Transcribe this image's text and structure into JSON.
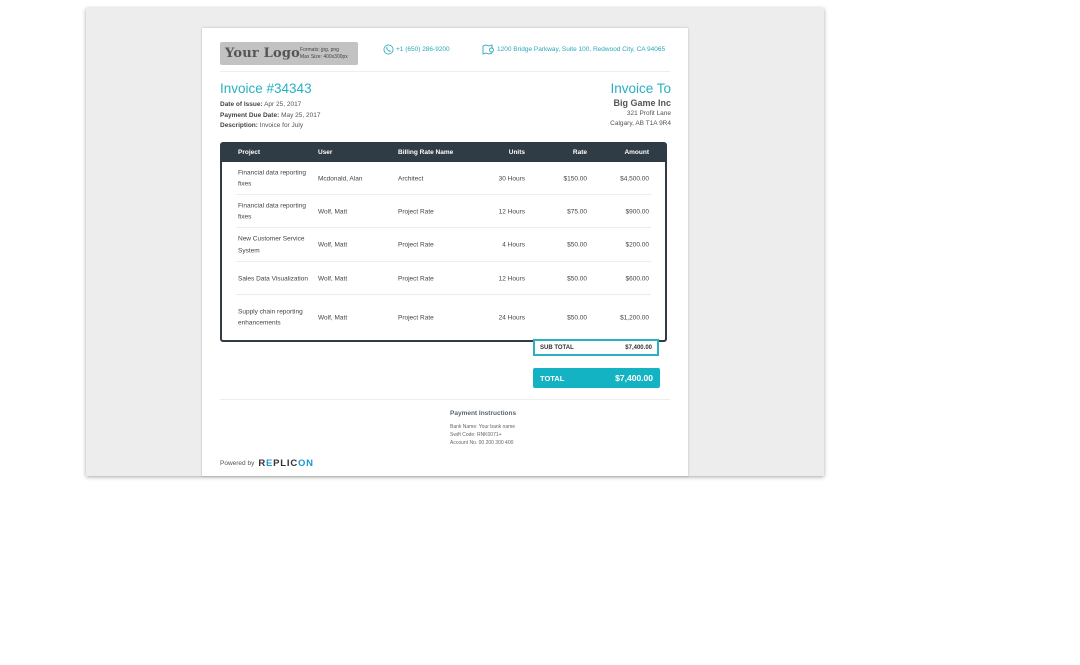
{
  "logo": {
    "text": "Your Logo",
    "formats": "Formats: jpg, png",
    "max_size": "Max Size: 400x300px"
  },
  "header": {
    "phone": "+1 (650) 286-9200",
    "address": "1200 Bridge Parkway, Suite 100, Redwood City, CA 94065"
  },
  "invoice": {
    "title": "Invoice #34343",
    "date_label": "Date of Issue:",
    "date_value": "Apr 25, 2017",
    "due_label": "Payment Due Date:",
    "due_value": "May 25, 2017",
    "desc_label": "Description:",
    "desc_value": "Invoice for July"
  },
  "invoice_to": {
    "title": "Invoice To",
    "company": "Big Game Inc",
    "address_line1": "321 Profit Lane",
    "address_line2": "Calgary, AB T1A 9R4"
  },
  "table": {
    "headers": [
      "Project",
      "User",
      "Billing Rate Name",
      "Units",
      "Rate",
      "Amount"
    ],
    "rows": [
      {
        "project": "Financial data reporting fixes",
        "user": "Mcdonald, Alan",
        "billing": "Architect",
        "units": "30 Hours",
        "rate": "$150.00",
        "amount": "$4,500.00"
      },
      {
        "project": "Financial data reporting fixes",
        "user": "Wolf, Matt",
        "billing": "Project Rate",
        "units": "12 Hours",
        "rate": "$75.00",
        "amount": "$900.00"
      },
      {
        "project": "New Customer Service System",
        "user": "Wolf, Matt",
        "billing": "Project Rate",
        "units": "4 Hours",
        "rate": "$50.00",
        "amount": "$200.00"
      },
      {
        "project": "Sales Data Visualization",
        "user": "Wolf, Matt",
        "billing": "Project Rate",
        "units": "12 Hours",
        "rate": "$50.00",
        "amount": "$600.00"
      },
      {
        "project": "Supply chain reporting enhancements",
        "user": "Wolf, Matt",
        "billing": "Project Rate",
        "units": "24 Hours",
        "rate": "$50.00",
        "amount": "$1,200.00"
      }
    ]
  },
  "totals": {
    "subtotal_label": "SUB TOTAL",
    "subtotal_value": "$7,400.00",
    "total_label": "TOTAL",
    "total_value": "$7,400.00"
  },
  "payment": {
    "title": "Payment Instructions",
    "bank": "Bank Name: Your bank name",
    "swift": "Swift Code: RNK0071+",
    "account": "Account No. 00 200 300 400"
  },
  "footer": {
    "powered_by": "Powered by",
    "brand_pre": "R",
    "brand_accent": "E",
    "brand_mid": "PLIC",
    "brand_accent2": "ON"
  },
  "colors": {
    "accent": "#2ab0c0",
    "header_dark": "#2f3b45",
    "total_bg": "#14b3c4"
  }
}
